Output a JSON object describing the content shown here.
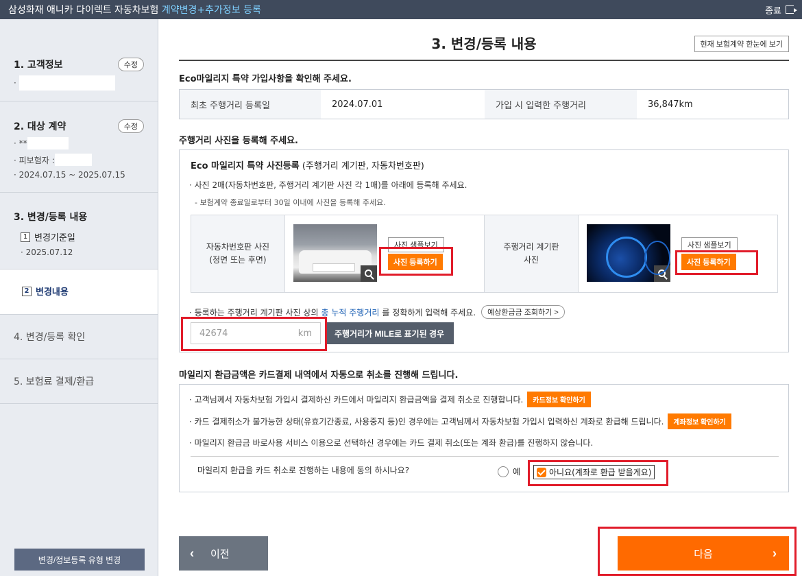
{
  "topbar": {
    "brand": "삼성화재 애니카 다이렉트 자동차보험",
    "brand_accent": "계약변경+추가정보 등록",
    "close_label": "종료"
  },
  "sidebar": {
    "sec1_title": "1. 고객정보",
    "edit_label": "수정",
    "sec2_title": "2. 대상 계약",
    "sec2_line1": "· **",
    "sec2_line2": "· 피보험자 :",
    "sec2_line3": "· 2024.07.15 ~ 2025.07.15",
    "sec3_title": "3. 변경/등록 내용",
    "step1_num": "1",
    "step1_label": "변경기준일",
    "step1_date": "· 2025.07.12",
    "step2_num": "2",
    "step2_label": "변경내용",
    "sec4_title": "4. 변경/등록 확인",
    "sec5_title": "5. 보험료 결제/환급",
    "bottom_btn": "변경/정보등록 유형 변경"
  },
  "main": {
    "page_title": "3. 변경/등록 내용",
    "view_btn": "현재 보험계약 한눈에 보기",
    "eco_heading": "Eco마일리지 특약 가입사항을 확인해 주세요.",
    "info": {
      "label1": "최초 주행거리 등록일",
      "value1": "2024.07.01",
      "label2": "가입 시 입력한 주행거리",
      "value2": "36,847km"
    },
    "photo_heading": "주행거리 사진을 등록해 주세요.",
    "photo_box_title_bold": "Eco 마일리지 특약 사진등록",
    "photo_box_title_rest": " (주행거리 계기판, 자동차번호판)",
    "photo_bullet": "· 사진 2매(자동차번호판, 주행거리 계기판 사진 각 1매)를 아래에 등록해 주세요.",
    "photo_note": "- 보험계약 종료일로부터 30일 이내에 사진을 등록해 주세요.",
    "plate_label": "자동차번호판 사진\n(정면 또는 후면)",
    "dash_label": "주행거리 계기판\n사진",
    "sample_btn": "사진 샘플보기",
    "register_btn": "사진 등록하기",
    "mileage_bullet_pre": "· 등록하는 주행거리 계기판 사진 상의 ",
    "mileage_bullet_hl": "총 누적 주행거리",
    "mileage_bullet_post": "를 정확하게 입력해 주세요.",
    "refund_lookup_btn": "예상환급금 조회하기 >",
    "km_value": "42674",
    "km_unit": "km",
    "mile_btn": "주행거리가 MILE로 표기된 경우",
    "refund_heading": "마일리지 환급금액은 카드결제 내역에서 자동으로 취소를 진행해 드립니다.",
    "refund_line1": "· 고객님께서 자동차보험 가입시 결제하신 카드에서 마일리지 환급금액을 결제 취소로 진행합니다.",
    "card_btn": "카드정보 확인하기",
    "refund_line2": "· 카드 결제취소가 불가능한 상태(유효기간종료, 사용중지 등)인 경우에는 고객님께서 자동차보험 가입시 입력하신 계좌로 환급해 드립니다.",
    "account_btn": "계좌정보 확인하기",
    "refund_line3": "· 마일리지 환급금 바로사용 서비스 이용으로 선택하신 경우에는 카드 결제 취소(또는 계좌 환급)를 진행하지 않습니다.",
    "consent_q": "마일리지 환급을 카드 취소로 진행하는 내용에 동의 하시나요?",
    "yes_label": "예",
    "no_label": "아니요(계좌로 환급 받을게요)",
    "prev_label": "이전",
    "next_label": "다음"
  },
  "colors": {
    "accent_orange": "#ff7a00",
    "highlight_red": "#e11c2a",
    "topbar_bg": "#3f4a5c"
  }
}
